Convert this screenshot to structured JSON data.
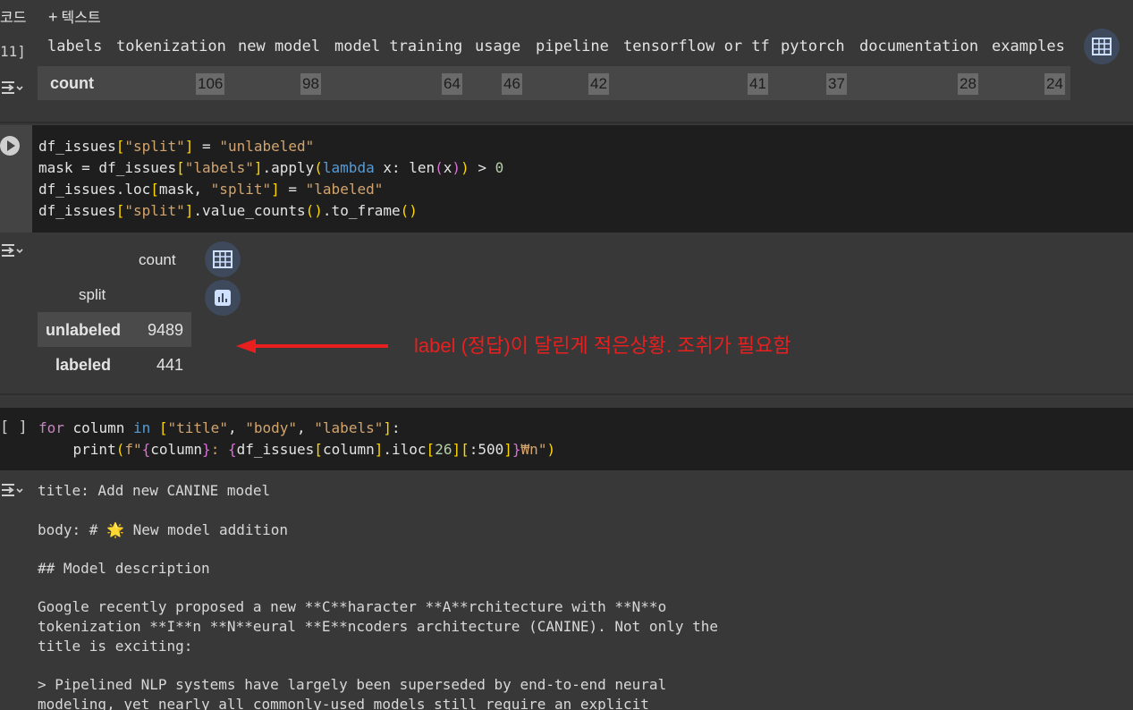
{
  "toolbar": {
    "code_label": "코드",
    "text_label": "텍스트",
    "plus": "+"
  },
  "cell1": {
    "exec_count": "11]",
    "columns": [
      "labels",
      "tokenization",
      "new model",
      "model training",
      "usage",
      "pipeline",
      "tensorflow or tf",
      "pytorch",
      "documentation",
      "examples"
    ],
    "row_label": "count",
    "values": [
      "106",
      "98",
      "64",
      "46",
      "42",
      "41",
      "37",
      "28",
      "24"
    ]
  },
  "cell2": {
    "code": [
      [
        [
          "df_issues",
          "def"
        ],
        [
          "[",
          "brk"
        ],
        [
          "\"split\"",
          "str"
        ],
        [
          "]",
          "brk"
        ],
        [
          " = ",
          "def"
        ],
        [
          "\"unlabeled\"",
          "str"
        ]
      ],
      [
        [
          "mask = df_issues",
          "def"
        ],
        [
          "[",
          "brk"
        ],
        [
          "\"labels\"",
          "str"
        ],
        [
          "]",
          "brk"
        ],
        [
          ".apply",
          "def"
        ],
        [
          "(",
          "brk"
        ],
        [
          "lambda",
          "key"
        ],
        [
          " x: len",
          "def"
        ],
        [
          "(",
          "mag"
        ],
        [
          "x",
          "def"
        ],
        [
          ")",
          "mag"
        ],
        [
          ")",
          "brk"
        ],
        [
          " > ",
          "def"
        ],
        [
          "0",
          "num"
        ]
      ],
      [
        [
          "df_issues.loc",
          "def"
        ],
        [
          "[",
          "brk"
        ],
        [
          "mask, ",
          "def"
        ],
        [
          "\"split\"",
          "str"
        ],
        [
          "]",
          "brk"
        ],
        [
          " = ",
          "def"
        ],
        [
          "\"labeled\"",
          "str"
        ]
      ],
      [
        [
          "df_issues",
          "def"
        ],
        [
          "[",
          "brk"
        ],
        [
          "\"split\"",
          "str"
        ],
        [
          "]",
          "brk"
        ],
        [
          ".value_counts",
          "def"
        ],
        [
          "()",
          "brk"
        ],
        [
          ".to_frame",
          "def"
        ],
        [
          "()",
          "brk"
        ]
      ]
    ],
    "table": {
      "col_header": "count",
      "index_name": "split",
      "rows": [
        {
          "name": "unlabeled",
          "value": "9489"
        },
        {
          "name": "labeled",
          "value": "441"
        }
      ]
    },
    "annotation": "label (정답)이 달린게 적은상황. 조취가 필요함",
    "annotation_color": "#e81f1f"
  },
  "cell3": {
    "bracket": "[ ]",
    "code": [
      [
        [
          "for",
          "kw"
        ],
        [
          " column ",
          "def"
        ],
        [
          "in",
          "key"
        ],
        [
          " ",
          "def"
        ],
        [
          "[",
          "brk"
        ],
        [
          "\"title\"",
          "str"
        ],
        [
          ", ",
          "def"
        ],
        [
          "\"body\"",
          "str"
        ],
        [
          ", ",
          "def"
        ],
        [
          "\"labels\"",
          "str"
        ],
        [
          "]",
          "brk"
        ],
        [
          ":",
          "def"
        ]
      ],
      [
        [
          "    print",
          "def"
        ],
        [
          "(",
          "brk"
        ],
        [
          "f\"",
          "str"
        ],
        [
          "{",
          "mag"
        ],
        [
          "column",
          "def"
        ],
        [
          "}",
          "mag"
        ],
        [
          ": ",
          "str"
        ],
        [
          "{",
          "mag"
        ],
        [
          "df_issues",
          "def"
        ],
        [
          "[",
          "brk"
        ],
        [
          "column",
          "def"
        ],
        [
          "]",
          "brk"
        ],
        [
          ".iloc",
          "def"
        ],
        [
          "[",
          "brk"
        ],
        [
          "26",
          "num"
        ],
        [
          "]",
          "brk"
        ],
        [
          "[",
          "brk"
        ],
        [
          ":500",
          "def"
        ],
        [
          "]",
          "brk"
        ],
        [
          "}",
          "mag"
        ],
        [
          "₩n\"",
          "str"
        ],
        [
          ")",
          "brk"
        ]
      ]
    ],
    "output": [
      "title: Add new CANINE model",
      "body: # 🌟 New model addition",
      "## Model description",
      "Google recently proposed a new **C**haracter **A**rchitecture with **N**o",
      "tokenization **I**n **N**eural **E**ncoders architecture (CANINE). Not only the",
      "title is exciting:",
      "> Pipelined NLP systems have largely been superseded by end-to-end neural",
      "modeling, yet nearly all commonly-used models still require an explicit"
    ]
  },
  "colors": {
    "background": "#383838",
    "code_bg": "#1e1e1e",
    "string": "#d2a46e",
    "keyword": "#569cd6"
  }
}
